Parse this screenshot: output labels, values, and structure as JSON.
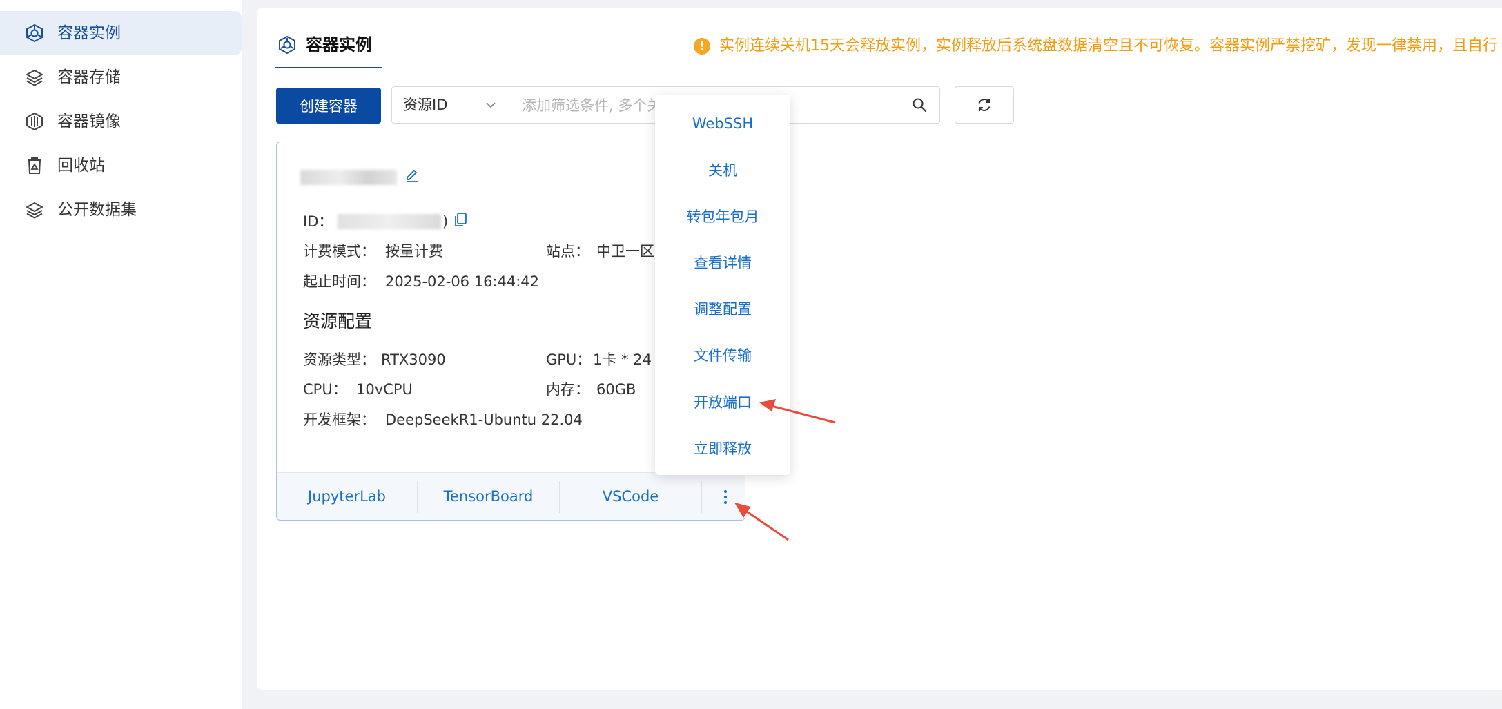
{
  "sidebar": {
    "items": [
      {
        "label": "容器实例",
        "icon": "container-instance-icon",
        "active": true
      },
      {
        "label": "容器存储",
        "icon": "layers-icon",
        "active": false
      },
      {
        "label": "容器镜像",
        "icon": "image-icon",
        "active": false
      },
      {
        "label": "回收站",
        "icon": "trash-icon",
        "active": false
      },
      {
        "label": "公开数据集",
        "icon": "dataset-icon",
        "active": false
      }
    ]
  },
  "header": {
    "tab_label": "容器实例",
    "notice_text": "实例连续关机15天会释放实例，实例释放后系统盘数据清空且不可恢复。容器实例严禁挖矿，发现一律禁用，且自行"
  },
  "toolbar": {
    "create_label": "创建容器",
    "filter_select": "资源ID",
    "filter_placeholder": "添加筛选条件, 多个关键字用竖线分隔"
  },
  "card": {
    "id_label": "ID：",
    "id_suffix": ")",
    "billing_label": "计费模式：",
    "billing_value": "按量计费",
    "site_label": "站点：",
    "site_value": "中卫一区",
    "time_label": "起止时间：",
    "time_value": "2025-02-06 16:44:42",
    "resource_title": "资源配置",
    "resource_type_label": "资源类型：",
    "resource_type_value": "RTX3090",
    "gpu_label": "GPU：",
    "gpu_value": "1卡 * 24",
    "cpu_label": "CPU：",
    "cpu_value": "10vCPU",
    "memory_label": "内存：",
    "memory_value": "60GB",
    "framework_label": "开发框架：",
    "framework_value": "DeepSeekR1-Ubuntu 22.04",
    "footer_links": [
      "JupyterLab",
      "TensorBoard",
      "VSCode"
    ],
    "more_icon": "more-vertical-icon"
  },
  "dropdown": {
    "items": [
      "WebSSH",
      "关机",
      "转包年包月",
      "查看详情",
      "调整配置",
      "文件传输",
      "开放端口",
      "立即释放"
    ]
  },
  "colors": {
    "accent": "#0b4aa2",
    "link": "#1a6fc9",
    "warning": "#f39c12",
    "annotation_arrow": "#e74c3c"
  }
}
